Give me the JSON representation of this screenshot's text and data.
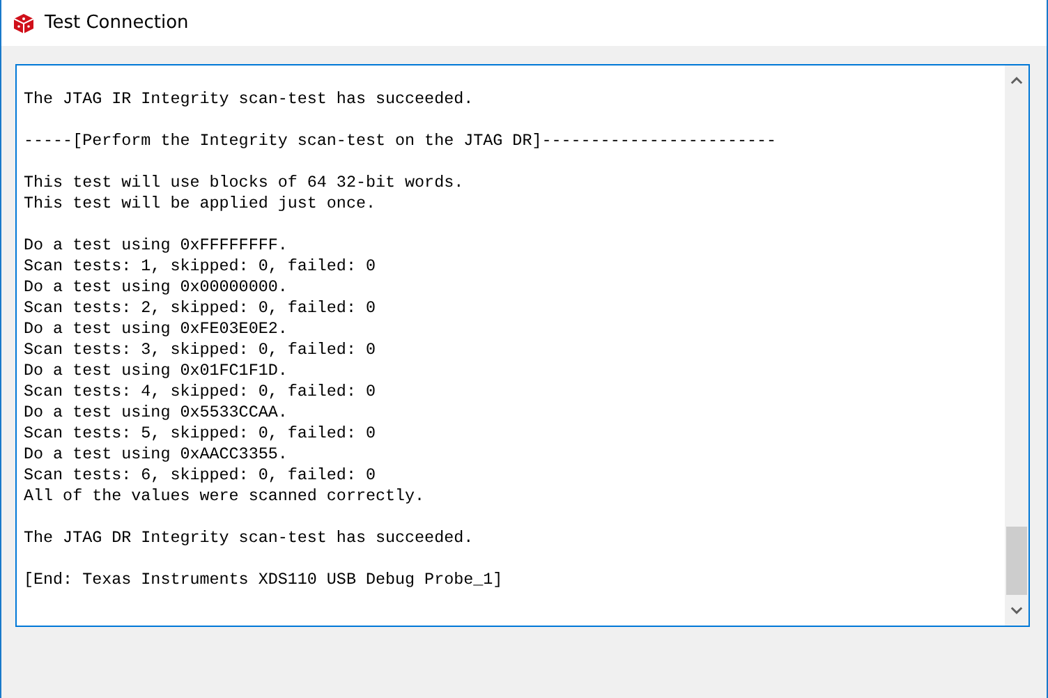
{
  "window": {
    "title": "Test Connection"
  },
  "output": {
    "blocks": [
      [
        "The JTAG IR Integrity scan-test has succeeded."
      ],
      [
        "-----[Perform the Integrity scan-test on the JTAG DR]------------------------"
      ],
      [
        "This test will use blocks of 64 32-bit words.",
        "This test will be applied just once."
      ],
      [
        "Do a test using 0xFFFFFFFF.",
        "Scan tests: 1, skipped: 0, failed: 0",
        "Do a test using 0x00000000.",
        "Scan tests: 2, skipped: 0, failed: 0",
        "Do a test using 0xFE03E0E2.",
        "Scan tests: 3, skipped: 0, failed: 0",
        "Do a test using 0x01FC1F1D.",
        "Scan tests: 4, skipped: 0, failed: 0",
        "Do a test using 0x5533CCAA.",
        "Scan tests: 5, skipped: 0, failed: 0",
        "Do a test using 0xAACC3355.",
        "Scan tests: 6, skipped: 0, failed: 0",
        "All of the values were scanned correctly."
      ],
      [
        "The JTAG DR Integrity scan-test has succeeded."
      ],
      [
        "[End: Texas Instruments XDS110 USB Debug Probe_1]"
      ]
    ]
  }
}
